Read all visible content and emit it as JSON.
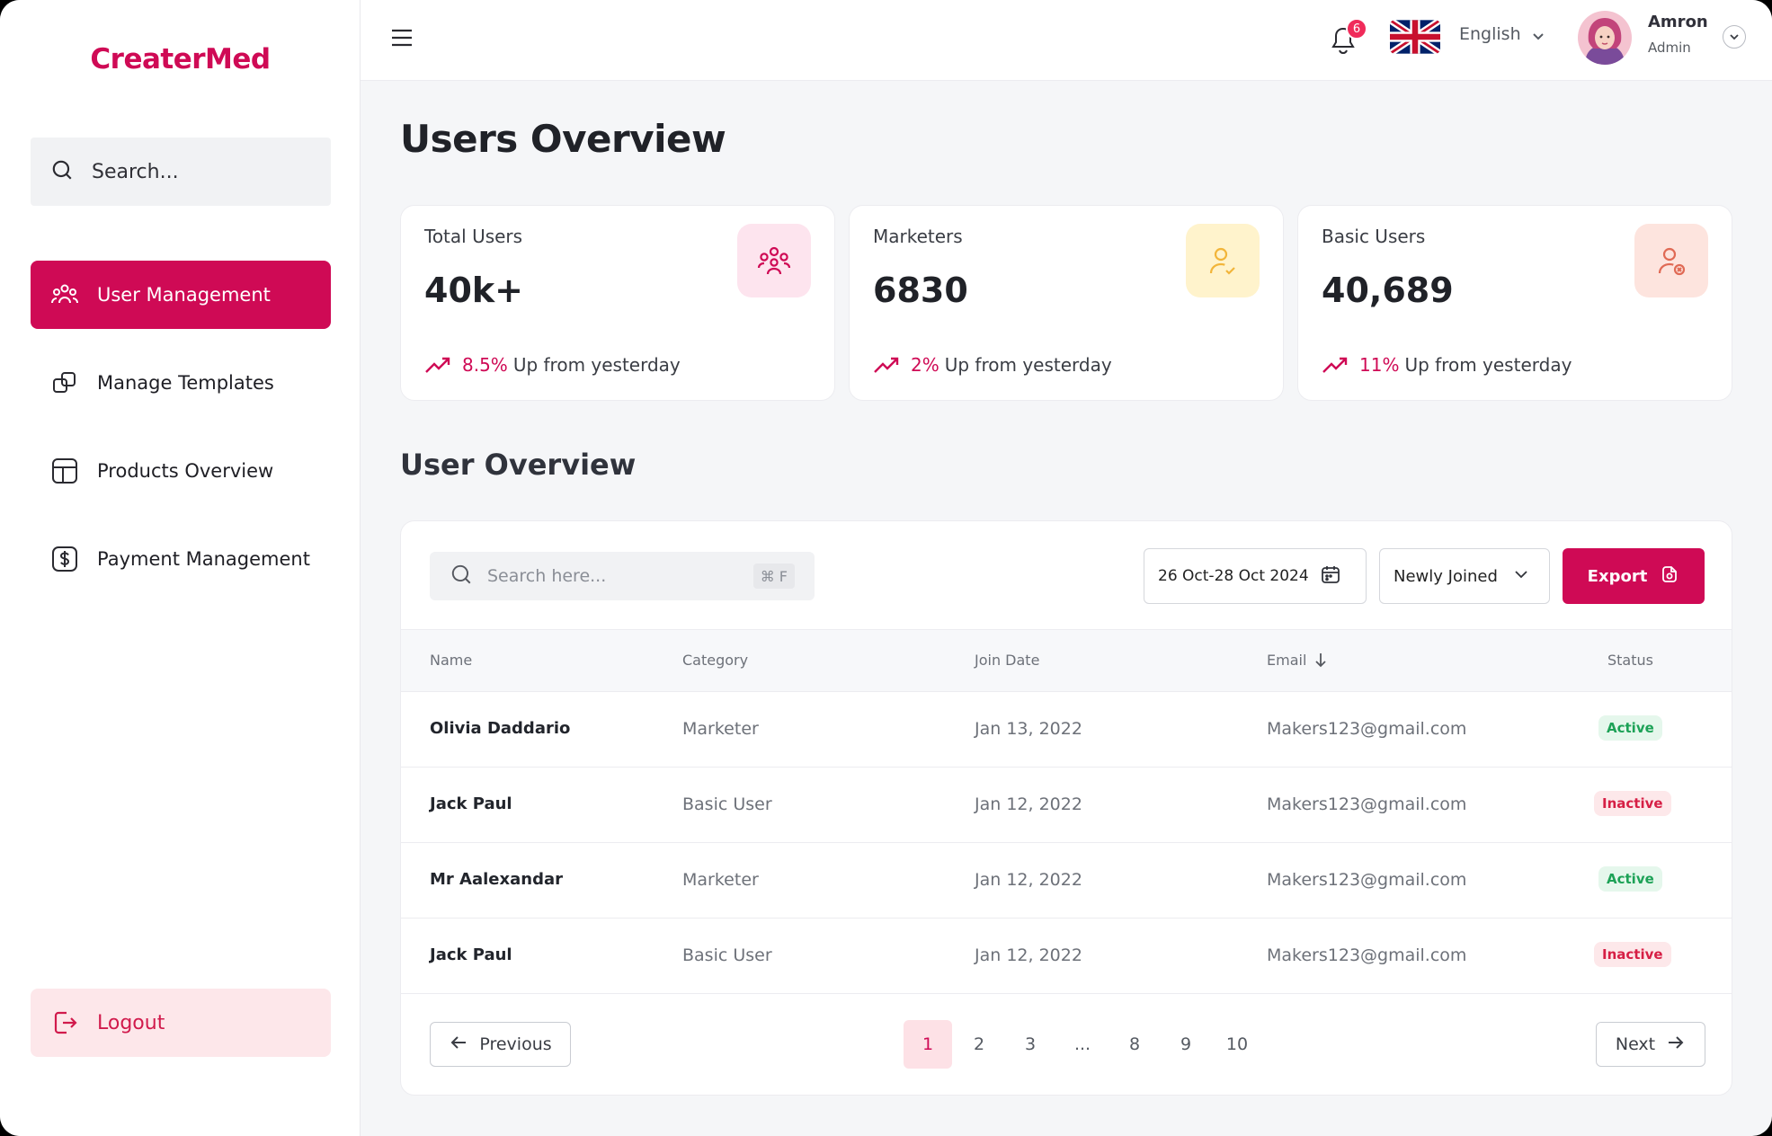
{
  "app": {
    "brand": "CreaterMed"
  },
  "sidebar": {
    "search_placeholder": "Search...",
    "items": [
      {
        "label": "User Management",
        "icon": "users-icon",
        "active": true
      },
      {
        "label": "Manage Templates",
        "icon": "templates-icon",
        "active": false
      },
      {
        "label": "Products Overview",
        "icon": "layout-icon",
        "active": false
      },
      {
        "label": "Payment Management",
        "icon": "dollar-icon",
        "active": false
      }
    ],
    "logout_label": "Logout"
  },
  "topbar": {
    "notification_count": "6",
    "language": "English",
    "user_name": "Amron",
    "user_role": "Admin"
  },
  "page": {
    "title": "Users Overview",
    "section_title": "User Overview"
  },
  "stats": [
    {
      "label": "Total Users",
      "value": "40k+",
      "pct": "8.5%",
      "trend_text": "Up from yesterday",
      "icon": "users-group-icon"
    },
    {
      "label": "Marketers",
      "value": "6830",
      "pct": "2%",
      "trend_text": "Up from yesterday",
      "icon": "user-check-icon"
    },
    {
      "label": "Basic Users",
      "value": "40,689",
      "pct": "11%",
      "trend_text": "Up from yesterday",
      "icon": "user-x-icon"
    }
  ],
  "colors": {
    "accent": "#cf0a55",
    "active": "#1da257",
    "inactive": "#d61f45"
  },
  "table": {
    "search_placeholder": "Search here...",
    "shortcut": "⌘ F",
    "date_range": "26 Oct-28 Oct 2024",
    "sort_value": "Newly Joined",
    "export_label": "Export",
    "columns": [
      "Name",
      "Category",
      "Join Date",
      "Email",
      "Status"
    ],
    "rows": [
      {
        "name": "Olivia Daddario",
        "category": "Marketer",
        "join_date": "Jan 13, 2022",
        "email": "Makers123@gmail.com",
        "status": "Active"
      },
      {
        "name": "Jack Paul",
        "category": "Basic User",
        "join_date": "Jan 12, 2022",
        "email": "Makers123@gmail.com",
        "status": "Inactive"
      },
      {
        "name": "Mr Aalexandar",
        "category": "Marketer",
        "join_date": "Jan 12, 2022",
        "email": "Makers123@gmail.com",
        "status": "Active"
      },
      {
        "name": "Jack Paul",
        "category": "Basic User",
        "join_date": "Jan 12, 2022",
        "email": "Makers123@gmail.com",
        "status": "Inactive"
      }
    ]
  },
  "pagination": {
    "prev_label": "Previous",
    "next_label": "Next",
    "pages": [
      "1",
      "2",
      "3",
      "...",
      "8",
      "9",
      "10"
    ],
    "current": "1"
  }
}
